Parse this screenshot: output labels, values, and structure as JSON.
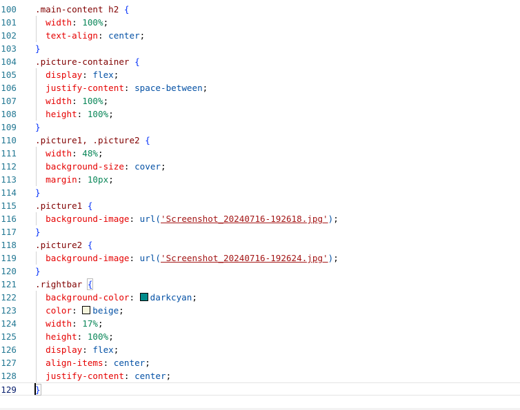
{
  "editor": {
    "colors": {
      "darkcyan": "#008b8b",
      "beige": "#f5f5dc"
    },
    "lines": [
      {
        "n": "100",
        "tokens": [
          {
            "t": ".main-content h2 ",
            "c": "sel"
          },
          {
            "t": "{",
            "c": "brace1"
          }
        ]
      },
      {
        "n": "101",
        "tokens": [
          {
            "t": "  width",
            "c": "prop"
          },
          {
            "t": ": ",
            "c": "pun"
          },
          {
            "t": "100%",
            "c": "num"
          },
          {
            "t": ";",
            "c": "pun"
          }
        ]
      },
      {
        "n": "102",
        "tokens": [
          {
            "t": "  text-align",
            "c": "prop"
          },
          {
            "t": ": ",
            "c": "pun"
          },
          {
            "t": "center",
            "c": "val"
          },
          {
            "t": ";",
            "c": "pun"
          }
        ]
      },
      {
        "n": "103",
        "tokens": [
          {
            "t": "}",
            "c": "brace1"
          }
        ]
      },
      {
        "n": "104",
        "tokens": [
          {
            "t": ".picture-container ",
            "c": "sel"
          },
          {
            "t": "{",
            "c": "brace1"
          }
        ]
      },
      {
        "n": "105",
        "tokens": [
          {
            "t": "  display",
            "c": "prop"
          },
          {
            "t": ": ",
            "c": "pun"
          },
          {
            "t": "flex",
            "c": "val"
          },
          {
            "t": ";",
            "c": "pun"
          }
        ]
      },
      {
        "n": "106",
        "tokens": [
          {
            "t": "  justify-content",
            "c": "prop"
          },
          {
            "t": ": ",
            "c": "pun"
          },
          {
            "t": "space-between",
            "c": "val"
          },
          {
            "t": ";",
            "c": "pun"
          }
        ]
      },
      {
        "n": "107",
        "tokens": [
          {
            "t": "  width",
            "c": "prop"
          },
          {
            "t": ": ",
            "c": "pun"
          },
          {
            "t": "100%",
            "c": "num"
          },
          {
            "t": ";",
            "c": "pun"
          }
        ]
      },
      {
        "n": "108",
        "tokens": [
          {
            "t": "  height",
            "c": "prop"
          },
          {
            "t": ": ",
            "c": "pun"
          },
          {
            "t": "100%",
            "c": "num"
          },
          {
            "t": ";",
            "c": "pun"
          }
        ]
      },
      {
        "n": "109",
        "tokens": [
          {
            "t": "}",
            "c": "brace1"
          }
        ]
      },
      {
        "n": "110",
        "tokens": [
          {
            "t": ".picture1, .picture2 ",
            "c": "sel"
          },
          {
            "t": "{",
            "c": "brace1"
          }
        ]
      },
      {
        "n": "111",
        "tokens": [
          {
            "t": "  width",
            "c": "prop"
          },
          {
            "t": ": ",
            "c": "pun"
          },
          {
            "t": "48%",
            "c": "num"
          },
          {
            "t": ";",
            "c": "pun"
          }
        ]
      },
      {
        "n": "112",
        "tokens": [
          {
            "t": "  background-size",
            "c": "prop"
          },
          {
            "t": ": ",
            "c": "pun"
          },
          {
            "t": "cover",
            "c": "val"
          },
          {
            "t": ";",
            "c": "pun"
          }
        ]
      },
      {
        "n": "113",
        "tokens": [
          {
            "t": "  margin",
            "c": "prop"
          },
          {
            "t": ": ",
            "c": "pun"
          },
          {
            "t": "10px",
            "c": "num"
          },
          {
            "t": ";",
            "c": "pun"
          }
        ]
      },
      {
        "n": "114",
        "tokens": [
          {
            "t": "}",
            "c": "brace1"
          }
        ]
      },
      {
        "n": "115",
        "tokens": [
          {
            "t": ".picture1 ",
            "c": "sel"
          },
          {
            "t": "{",
            "c": "brace1"
          }
        ]
      },
      {
        "n": "116",
        "tokens": [
          {
            "t": "  background-image",
            "c": "prop"
          },
          {
            "t": ": ",
            "c": "pun"
          },
          {
            "t": "url(",
            "c": "val"
          },
          {
            "t": "'Screenshot_20240716-192618.jpg'",
            "c": "str"
          },
          {
            "t": ")",
            "c": "val"
          },
          {
            "t": ";",
            "c": "pun"
          }
        ]
      },
      {
        "n": "117",
        "tokens": [
          {
            "t": "}",
            "c": "brace1"
          }
        ]
      },
      {
        "n": "118",
        "tokens": [
          {
            "t": ".picture2 ",
            "c": "sel"
          },
          {
            "t": "{",
            "c": "brace1"
          }
        ]
      },
      {
        "n": "119",
        "tokens": [
          {
            "t": "  background-image",
            "c": "prop"
          },
          {
            "t": ": ",
            "c": "pun"
          },
          {
            "t": "url(",
            "c": "val"
          },
          {
            "t": "'Screenshot_20240716-192624.jpg'",
            "c": "str"
          },
          {
            "t": ")",
            "c": "val"
          },
          {
            "t": ";",
            "c": "pun"
          }
        ]
      },
      {
        "n": "120",
        "tokens": [
          {
            "t": "}",
            "c": "brace1"
          }
        ]
      },
      {
        "n": "121",
        "tokens": [
          {
            "t": ".rightbar ",
            "c": "sel"
          },
          {
            "t": "{",
            "c": "brace1",
            "box": true
          }
        ]
      },
      {
        "n": "122",
        "tokens": [
          {
            "t": "  background-color",
            "c": "prop"
          },
          {
            "t": ": ",
            "c": "pun"
          },
          {
            "swatch": "darkcyan"
          },
          {
            "t": "darkcyan",
            "c": "val"
          },
          {
            "t": ";",
            "c": "pun"
          }
        ]
      },
      {
        "n": "123",
        "tokens": [
          {
            "t": "  color",
            "c": "prop"
          },
          {
            "t": ": ",
            "c": "pun"
          },
          {
            "swatch": "beige"
          },
          {
            "t": "beige",
            "c": "val"
          },
          {
            "t": ";",
            "c": "pun"
          }
        ]
      },
      {
        "n": "124",
        "tokens": [
          {
            "t": "  width",
            "c": "prop"
          },
          {
            "t": ": ",
            "c": "pun"
          },
          {
            "t": "17%",
            "c": "num"
          },
          {
            "t": ";",
            "c": "pun"
          }
        ]
      },
      {
        "n": "125",
        "tokens": [
          {
            "t": "  height",
            "c": "prop"
          },
          {
            "t": ": ",
            "c": "pun"
          },
          {
            "t": "100%",
            "c": "num"
          },
          {
            "t": ";",
            "c": "pun"
          }
        ]
      },
      {
        "n": "126",
        "tokens": [
          {
            "t": "  display",
            "c": "prop"
          },
          {
            "t": ": ",
            "c": "pun"
          },
          {
            "t": "flex",
            "c": "val"
          },
          {
            "t": ";",
            "c": "pun"
          }
        ]
      },
      {
        "n": "127",
        "tokens": [
          {
            "t": "  align-items",
            "c": "prop"
          },
          {
            "t": ": ",
            "c": "pun"
          },
          {
            "t": "center",
            "c": "val"
          },
          {
            "t": ";",
            "c": "pun"
          }
        ]
      },
      {
        "n": "128",
        "tokens": [
          {
            "t": "  justify-content",
            "c": "prop"
          },
          {
            "t": ": ",
            "c": "pun"
          },
          {
            "t": "center",
            "c": "val"
          },
          {
            "t": ";",
            "c": "pun"
          }
        ]
      },
      {
        "n": "129",
        "tokens": [
          {
            "t": "}",
            "c": "brace1",
            "box": true
          }
        ],
        "current": true
      }
    ]
  }
}
